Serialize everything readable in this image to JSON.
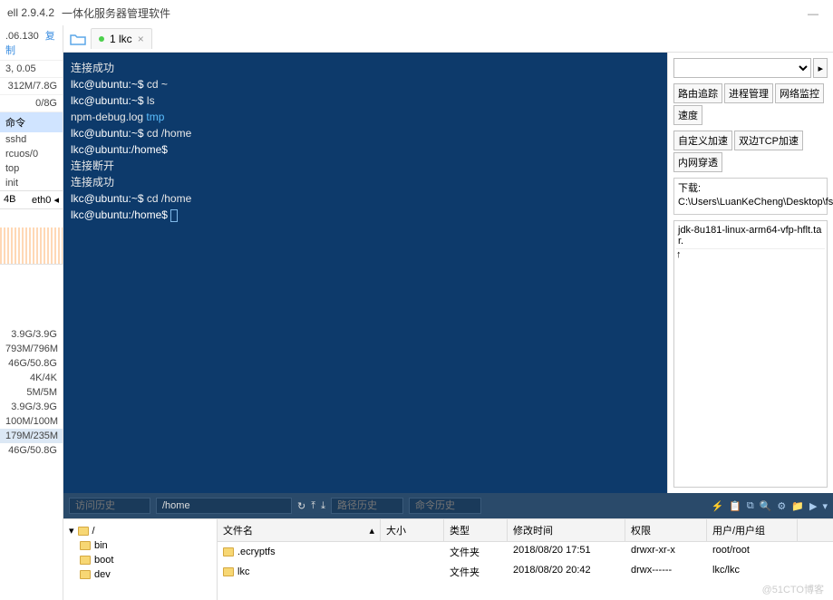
{
  "titlebar": {
    "version": "ell 2.9.4.2",
    "subtitle": "一体化服务器管理软件"
  },
  "sidebar": {
    "ip": ".06.130",
    "copy": "复制",
    "loadavg": "3, 0.05",
    "mem1": "312M/7.8G",
    "mem2": "0/8G",
    "cmd_header": "命令",
    "cmds": [
      "sshd",
      "rcuos/0",
      "top",
      "init"
    ],
    "eth_left": "4B",
    "eth_right": "eth0",
    "stats": [
      "3.9G/3.9G",
      "793M/796M",
      "46G/50.8G",
      "4K/4K",
      "5M/5M",
      "3.9G/3.9G",
      "100M/100M",
      "179M/235M",
      "46G/50.8G"
    ],
    "hl_index": 7
  },
  "tab": {
    "label": "1 lkc"
  },
  "terminal": {
    "lines": [
      {
        "t": "连接成功"
      },
      {
        "p": "lkc@ubuntu:~$",
        "c": " cd ~"
      },
      {
        "p": "lkc@ubuntu:~$",
        "c": " ls"
      },
      {
        "t": "npm-debug.log  ",
        "d": "tmp"
      },
      {
        "p": "lkc@ubuntu:~$",
        "c": " cd /home"
      },
      {
        "p": "lkc@ubuntu:/home$",
        "c": ""
      },
      {
        "t": "连接断开"
      },
      {
        "t": "连接成功"
      },
      {
        "p": "lkc@ubuntu:~$",
        "c": " cd /home"
      },
      {
        "p": "lkc@ubuntu:/home$",
        "c": " ",
        "cursor": true
      }
    ]
  },
  "statusbar": {
    "history_label": "访问历史",
    "path": "/home",
    "path_history": "路径历史",
    "cmd_history": "命令历史"
  },
  "rightpanel": {
    "buttons_row1": [
      "路由追踪",
      "进程管理",
      "网络监控",
      "速度"
    ],
    "buttons_row2": [
      "自定义加速",
      "双边TCP加速",
      "内网穿透"
    ],
    "download_label": "下载:",
    "download_path": "C:\\Users\\LuanKeCheng\\Desktop\\fsdownload",
    "file": "jdk-8u181-linux-arm64-vfp-hflt.tar.",
    "arrow": "↑"
  },
  "filebrowser": {
    "tree": [
      "/",
      "bin",
      "boot",
      "dev"
    ],
    "columns": {
      "name": "文件名",
      "size": "大小",
      "type": "类型",
      "mtime": "修改时间",
      "perm": "权限",
      "owner": "用户/用户组"
    },
    "rows": [
      {
        "name": ".ecryptfs",
        "size": "",
        "type": "文件夹",
        "mtime": "2018/08/20 17:51",
        "perm": "drwxr-xr-x",
        "owner": "root/root"
      },
      {
        "name": "lkc",
        "size": "",
        "type": "文件夹",
        "mtime": "2018/08/20 20:42",
        "perm": "drwx------",
        "owner": "lkc/lkc"
      }
    ]
  },
  "watermark": "@51CTO博客"
}
